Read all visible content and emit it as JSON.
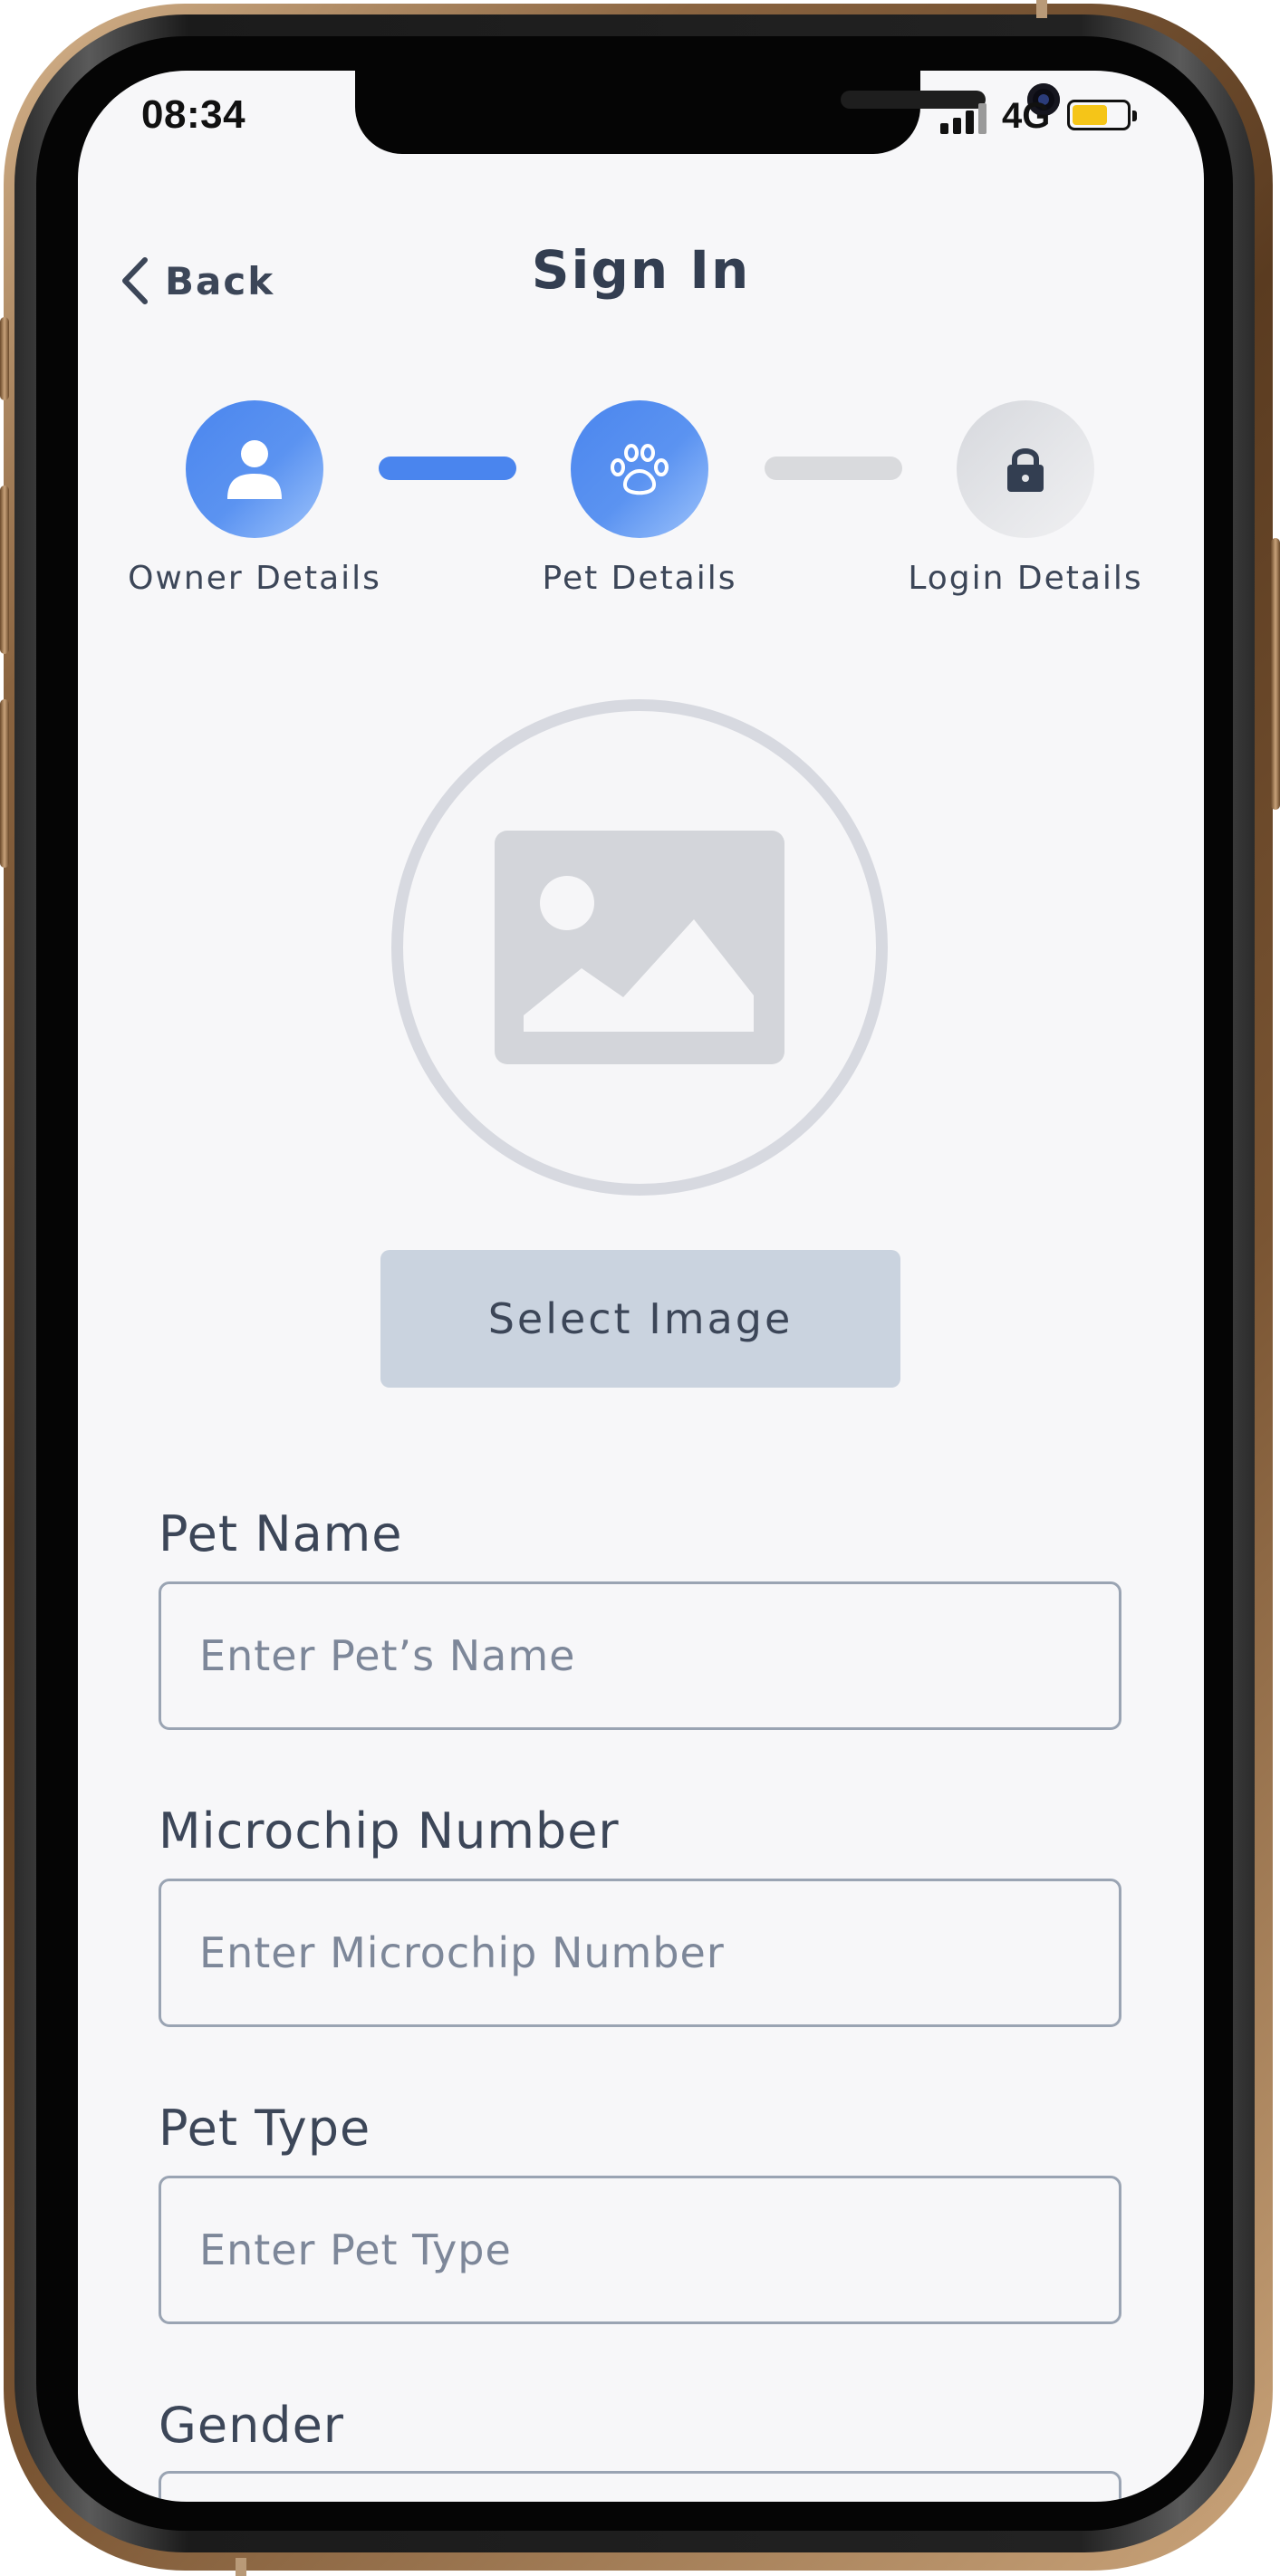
{
  "status_bar": {
    "time": "08:34",
    "network": "4G"
  },
  "header": {
    "back_label": "Back",
    "title": "Sign In"
  },
  "steps": [
    {
      "label": "Owner Details",
      "icon": "user-icon",
      "state": "completed"
    },
    {
      "label": "Pet Details",
      "icon": "paw-icon",
      "state": "current"
    },
    {
      "label": "Login Details",
      "icon": "lock-icon",
      "state": "upcoming"
    }
  ],
  "image_picker": {
    "placeholder_icon": "image-icon",
    "button_label": "Select Image"
  },
  "form": {
    "pet_name": {
      "label": "Pet Name",
      "placeholder": "Enter Pet’s Name"
    },
    "microchip": {
      "label": "Microchip Number",
      "placeholder": "Enter Microchip Number"
    },
    "pet_type": {
      "label": "Pet Type",
      "placeholder": "Enter Pet Type"
    },
    "gender": {
      "label": "Gender"
    }
  },
  "colors": {
    "accent": "#4F8AEF",
    "text": "#3C4658",
    "background": "#F7F7F9",
    "inactive": "#D9DADE",
    "button": "#CAD3DF"
  }
}
